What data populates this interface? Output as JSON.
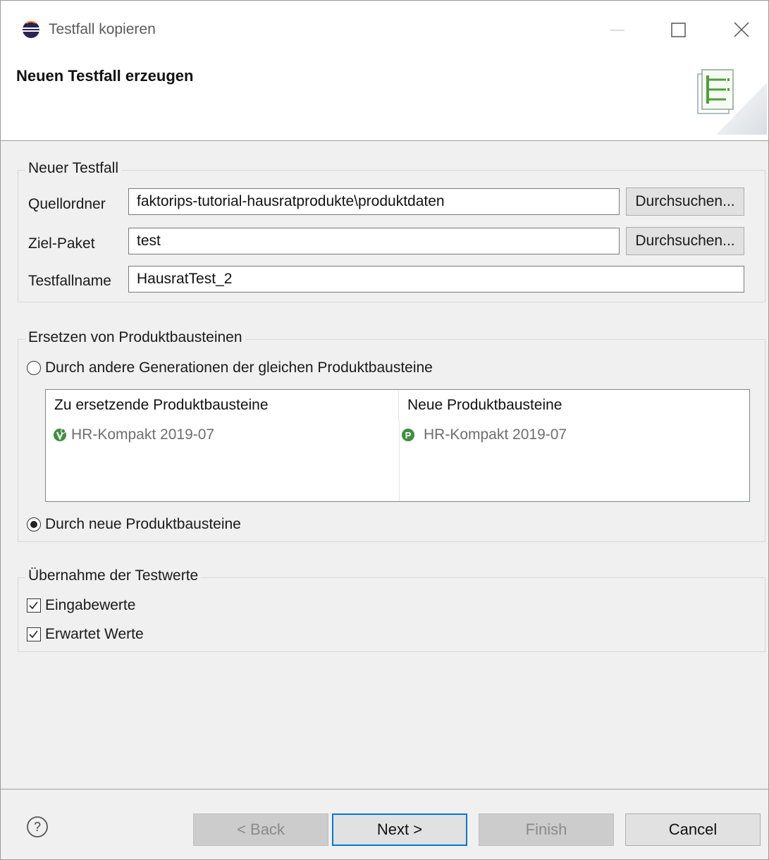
{
  "window": {
    "title": "Testfall kopieren"
  },
  "banner": {
    "title": "Neuen Testfall erzeugen"
  },
  "group_new": {
    "label": "Neuer Testfall",
    "source_folder": {
      "label": "Quellordner",
      "value": "faktorips-tutorial-hausratprodukte\\produktdaten",
      "browse": "Durchsuchen..."
    },
    "target_package": {
      "label": "Ziel-Paket",
      "value": "test",
      "browse": "Durchsuchen..."
    },
    "testcase_name": {
      "label": "Testfallname",
      "value": "HausratTest_2"
    }
  },
  "group_replace": {
    "label": "Ersetzen von Produktbausteinen",
    "option_generations": {
      "label": "Durch andere Generationen der gleichen Produktbausteine",
      "checked": false
    },
    "table": {
      "headers": [
        "Zu ersetzende Produktbausteine",
        "Neue Produktbausteine"
      ],
      "rows": [
        {
          "old": "HR-Kompakt 2019-07",
          "new": "HR-Kompakt 2019-07"
        }
      ]
    },
    "option_new": {
      "label": "Durch neue Produktbausteine",
      "checked": true
    }
  },
  "group_values": {
    "label": "Übernahme der Testwerte",
    "input_values": {
      "label": "Eingabewerte",
      "checked": true
    },
    "expected_values": {
      "label": "Erwartet Werte",
      "checked": true
    }
  },
  "buttons": {
    "back": "< Back",
    "next": "Next >",
    "finish": "Finish",
    "cancel": "Cancel"
  },
  "colors": {
    "accent": "#0078d7",
    "product_green": "#3f8f3f"
  }
}
